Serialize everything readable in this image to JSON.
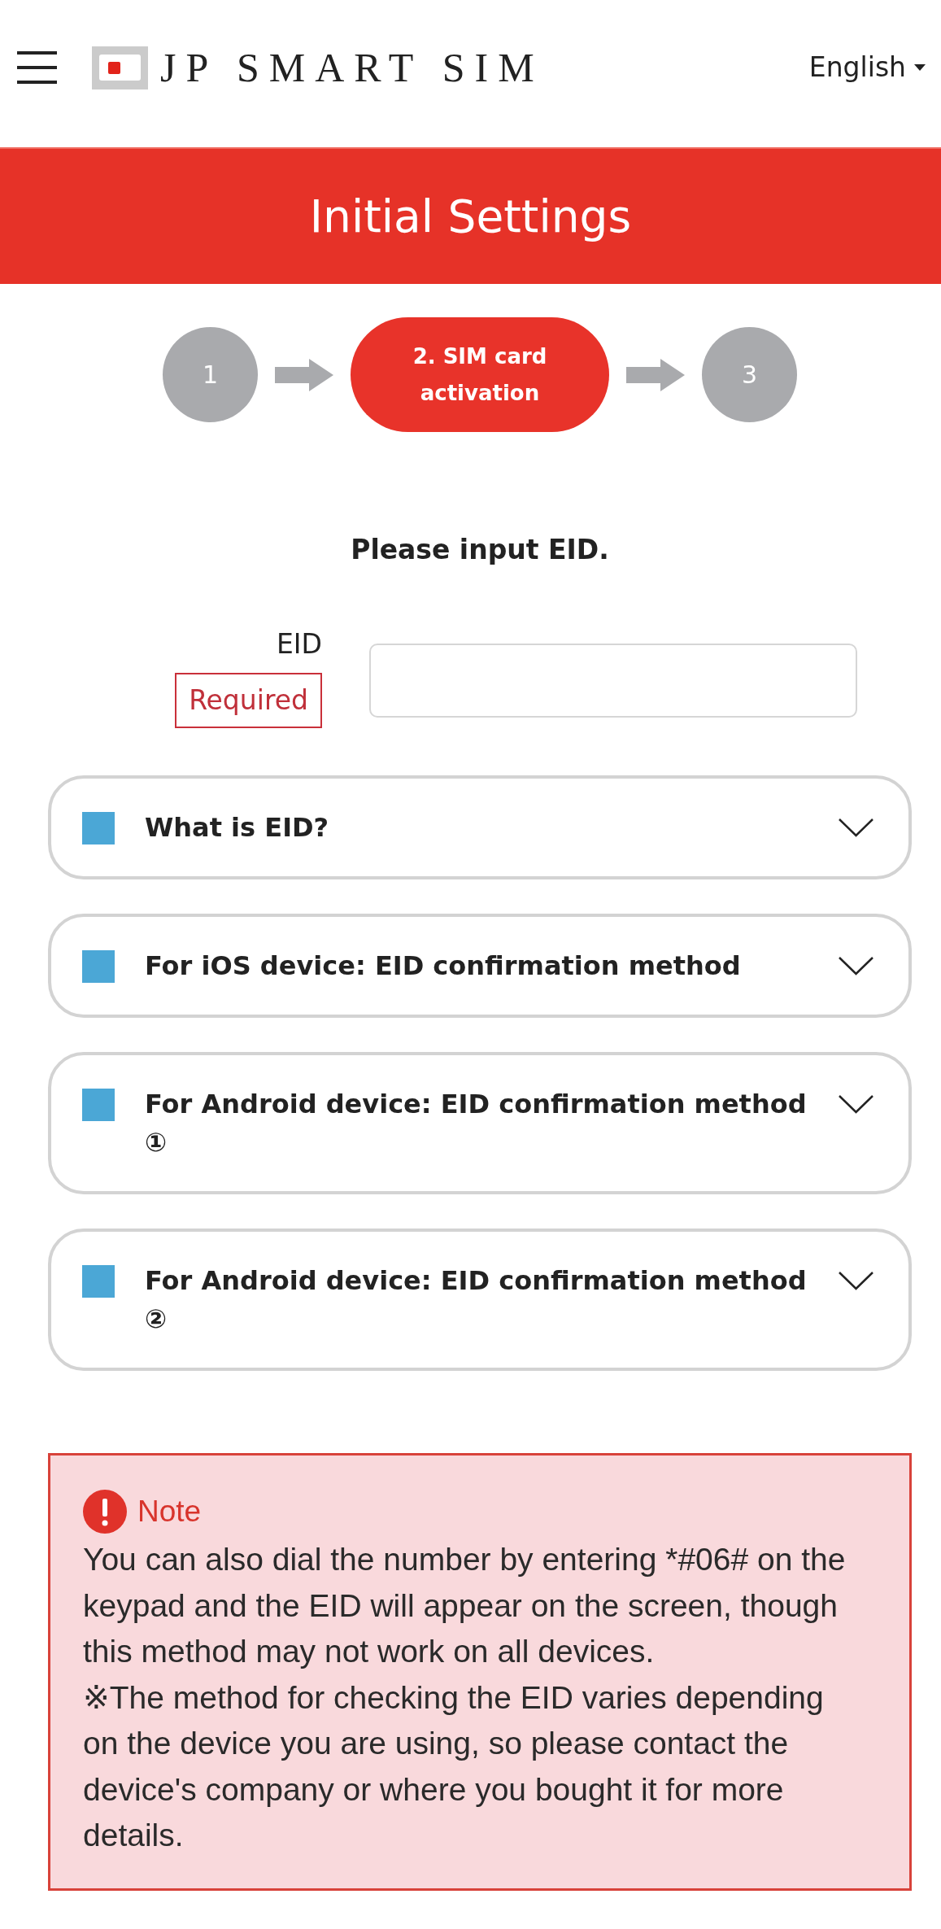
{
  "header": {
    "logo_text": "JP SMART SIM",
    "language": "English"
  },
  "page_title": "Initial Settings",
  "steps": [
    {
      "label": "1",
      "selected": false
    },
    {
      "label": "2. SIM card activation",
      "selected": true
    },
    {
      "label": "3",
      "selected": false
    }
  ],
  "prompt": "Please input EID.",
  "form": {
    "label": "EID",
    "badge": "Required"
  },
  "accordions": [
    {
      "title": "What is EID?",
      "expanded": false
    },
    {
      "title": "For iOS device: EID confirmation method",
      "expanded": false
    },
    {
      "title": "For Android device: EID confirmation method ①",
      "expanded": false
    },
    {
      "title": "For Android device: EID confirmation method ②",
      "expanded": false
    }
  ],
  "note": {
    "title": "Note",
    "paragraphs": [
      "You can also dial the number by entering *#06# on the keypad and the EID will appear on the screen, though this method may not work on all devices.",
      "※The method for checking the EID varies depending on the device you are using, so please contact the device's company or where you bought it for more details."
    ]
  }
}
